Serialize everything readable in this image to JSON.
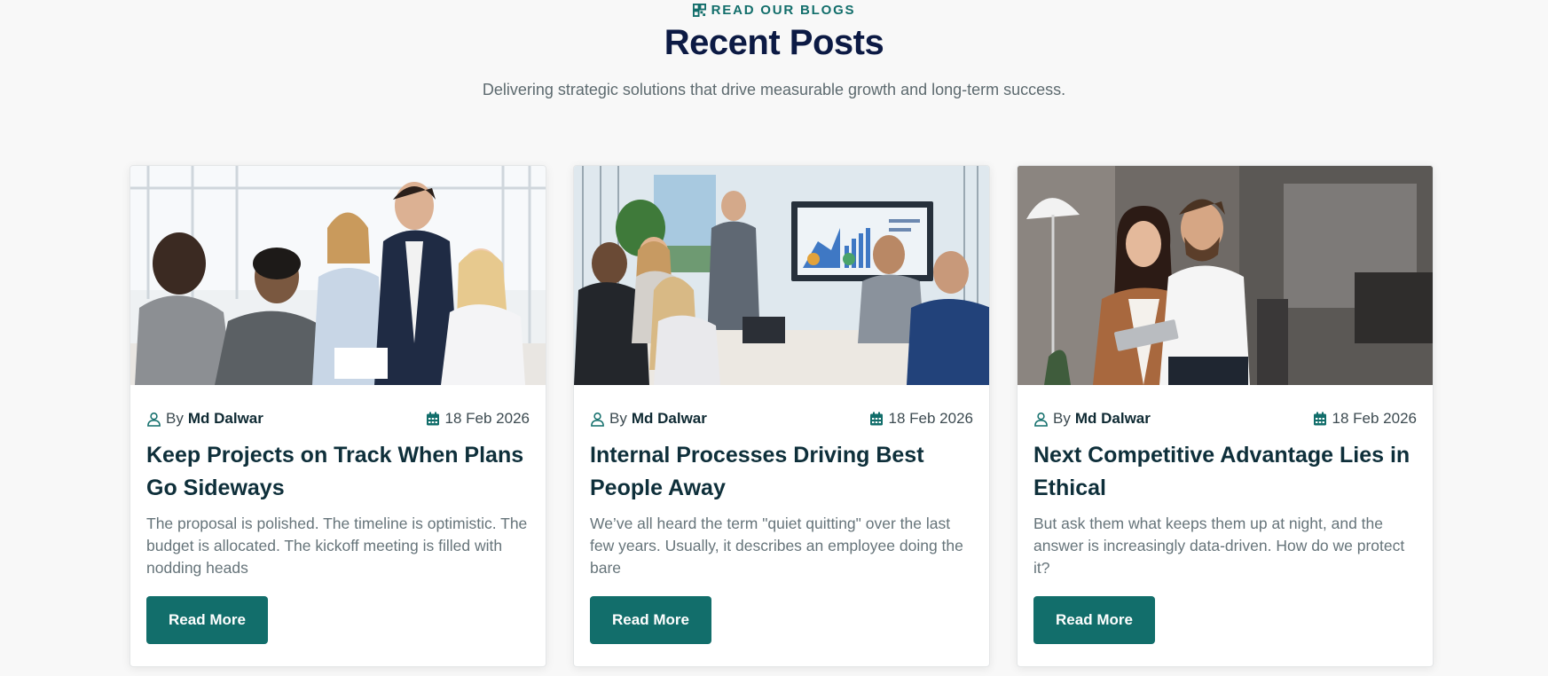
{
  "section": {
    "eyebrow": "READ OUR BLOGS",
    "title": "Recent Posts",
    "subtitle": "Delivering strategic solutions that drive measurable growth and long-term success."
  },
  "colors": {
    "accent": "#126e6b",
    "heading": "#0c1a44",
    "card_title": "#0e2f3a",
    "body_text": "#66747a",
    "background": "#f8f8f8"
  },
  "posts": [
    {
      "image_icon": "team-meeting-photo",
      "by_label": "By",
      "author": "Md Dalwar",
      "date": "18 Feb 2026",
      "title": "Keep Projects on Track When Plans Go Sideways",
      "excerpt": "The proposal is polished. The timeline is optimistic. The budget is allocated. The kickoff meeting is filled with nodding heads",
      "button": "Read More"
    },
    {
      "image_icon": "presentation-meeting-photo",
      "by_label": "By",
      "author": "Md Dalwar",
      "date": "18 Feb 2026",
      "title": "Internal Processes Driving Best People Away",
      "excerpt": "We’ve all heard the term \"quiet quitting\" over the last few years. Usually, it describes an employee doing the bare",
      "button": "Read More"
    },
    {
      "image_icon": "two-colleagues-tablet-photo",
      "by_label": "By",
      "author": "Md Dalwar",
      "date": "18 Feb 2026",
      "title": "Next Competitive Advantage Lies in Ethical",
      "excerpt": "But ask them what keeps them up at night, and the answer is increasingly data-driven. How do we protect it?",
      "button": "Read More"
    }
  ]
}
